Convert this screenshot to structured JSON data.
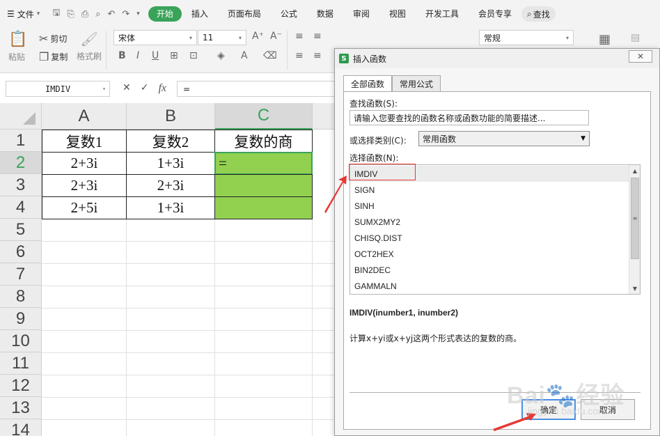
{
  "menubar": {
    "file_label": "文件",
    "tabs": [
      {
        "label": "开始",
        "active": true
      },
      {
        "label": "插入"
      },
      {
        "label": "页面布局"
      },
      {
        "label": "公式"
      },
      {
        "label": "数据"
      },
      {
        "label": "审阅"
      },
      {
        "label": "视图"
      },
      {
        "label": "开发工具"
      },
      {
        "label": "会员专享"
      }
    ],
    "search_label": "查找"
  },
  "ribbon": {
    "cut_label": "剪切",
    "copy_label": "复制",
    "paste_label": "粘贴",
    "format_painter_label": "格式刷",
    "font_name": "宋体",
    "font_size": "11",
    "number_format": "常规"
  },
  "formula_bar": {
    "name_box": "IMDIV",
    "fx_label": "fx",
    "formula": "="
  },
  "sheet": {
    "columns": [
      "A",
      "B",
      "C"
    ],
    "rows": [
      "1",
      "2",
      "3",
      "4",
      "5",
      "6",
      "7",
      "8",
      "9",
      "10",
      "11",
      "12",
      "13",
      "14"
    ],
    "cells": {
      "A1": "复数1",
      "B1": "复数2",
      "C1": "复数的商",
      "A2": "2+3i",
      "B2": "1+3i",
      "C2": "=",
      "A3": "2+3i",
      "B3": "2+3i",
      "A4": "2+5i",
      "B4": "1+3i"
    },
    "fill_color": "#92d050",
    "accent_color": "#3aa35a"
  },
  "dialog": {
    "title": "插入函数",
    "tabs": [
      "全部函数",
      "常用公式"
    ],
    "search_label": "查找函数(S):",
    "search_placeholder": "请输入您要查找的函数名称或函数功能的简要描述...",
    "category_label": "或选择类别(C):",
    "category_value": "常用函数",
    "list_label": "选择函数(N):",
    "functions": [
      "IMDIV",
      "SIGN",
      "SINH",
      "SUMX2MY2",
      "CHISQ.DIST",
      "OCT2HEX",
      "BIN2DEC",
      "GAMMALN"
    ],
    "selected_function": "IMDIV",
    "signature": "IMDIV(inumber1, inumber2)",
    "description": "计算x+yi或x+yj这两个形式表达的复数的商。",
    "ok_label": "确定",
    "cancel_label": "取消"
  }
}
